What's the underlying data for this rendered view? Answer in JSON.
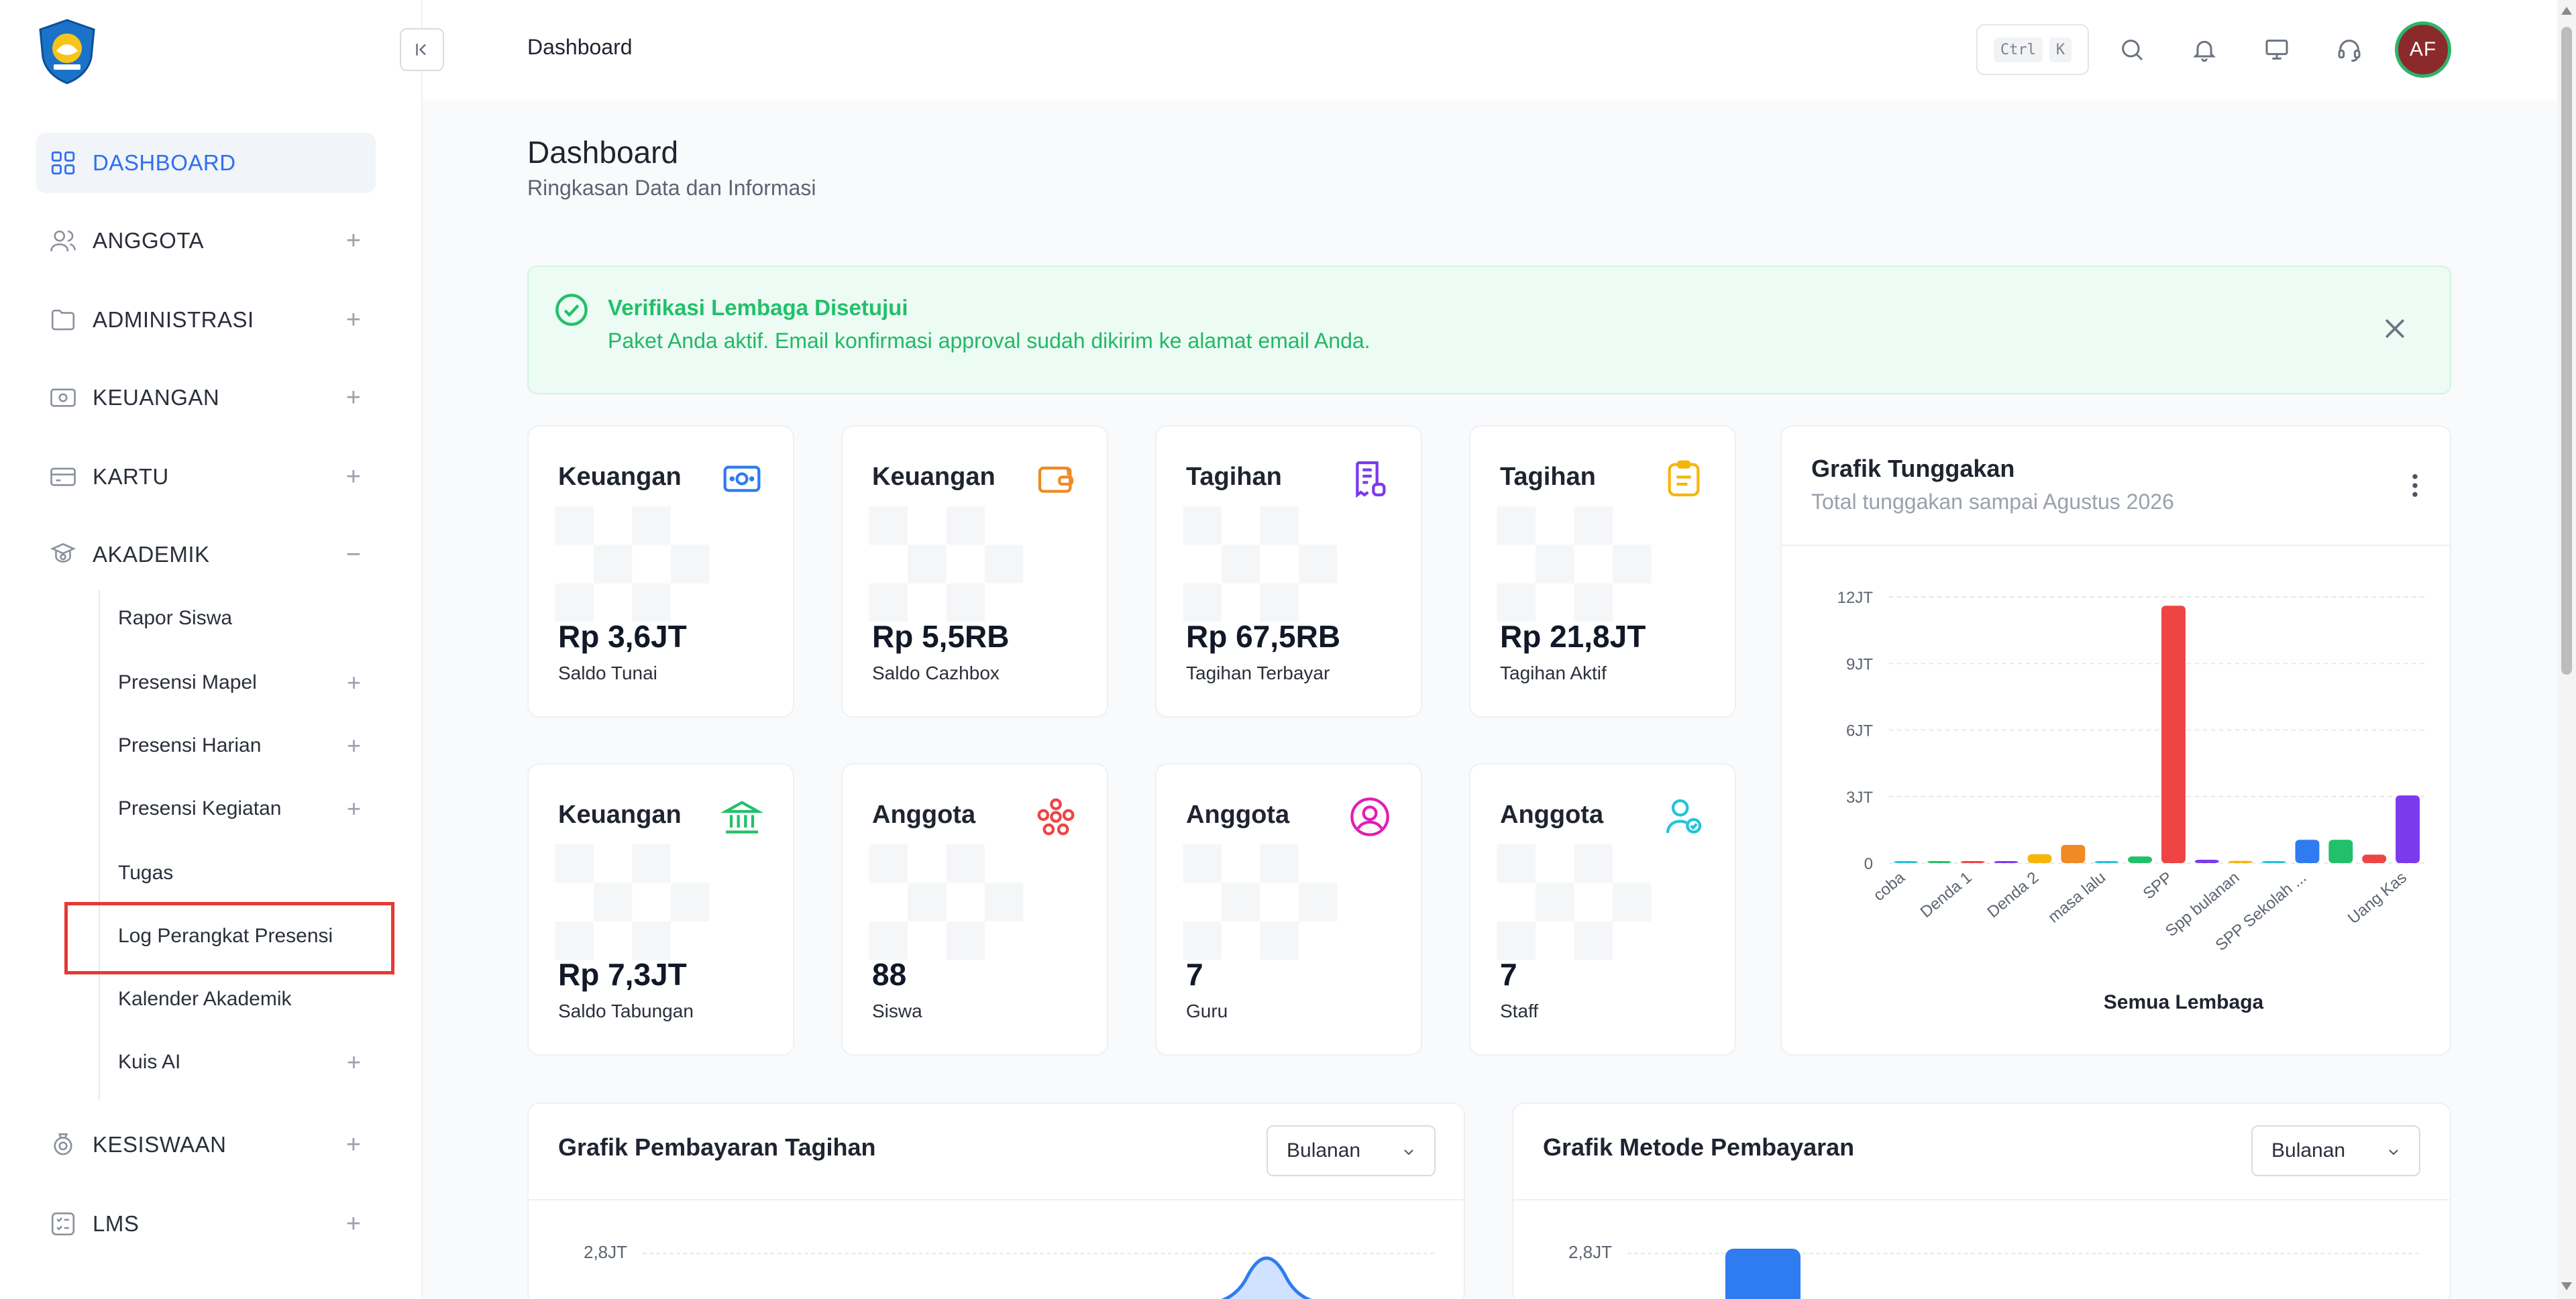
{
  "header": {
    "title": "Dashboard",
    "kbd_ctrl": "Ctrl",
    "kbd_k": "K",
    "avatar_initials": "AF"
  },
  "sidebar": {
    "items": [
      {
        "label": "DASHBOARD",
        "active": true,
        "icon": "grid-icon"
      },
      {
        "label": "ANGGOTA",
        "icon": "users-icon",
        "toggle": "+"
      },
      {
        "label": "ADMINISTRASI",
        "icon": "folder-icon",
        "toggle": "+"
      },
      {
        "label": "KEUANGAN",
        "icon": "banknote-icon",
        "toggle": "+"
      },
      {
        "label": "KARTU",
        "icon": "card-icon",
        "toggle": "+"
      },
      {
        "label": "AKADEMIK",
        "icon": "academic-icon",
        "toggle": "−"
      },
      {
        "label": "KESISWAAN",
        "icon": "student-icon",
        "toggle": "+"
      },
      {
        "label": "LMS",
        "icon": "list-icon",
        "toggle": "+"
      }
    ],
    "akademik_sub": [
      {
        "label": "Rapor Siswa"
      },
      {
        "label": "Presensi Mapel",
        "toggle": "+"
      },
      {
        "label": "Presensi Harian",
        "toggle": "+"
      },
      {
        "label": "Presensi Kegiatan",
        "toggle": "+"
      },
      {
        "label": "Tugas"
      },
      {
        "label": "Log Perangkat Presensi"
      },
      {
        "label": "Kalender Akademik"
      },
      {
        "label": "Kuis AI",
        "toggle": "+"
      }
    ]
  },
  "page": {
    "title": "Dashboard",
    "subtitle": "Ringkasan Data dan Informasi"
  },
  "alert": {
    "title": "Verifikasi Lembaga Disetujui",
    "message": "Paket Anda aktif. Email konfirmasi approval sudah dikirim ke alamat email Anda."
  },
  "cards": [
    {
      "title": "Keuangan",
      "value": "Rp 3,6JT",
      "label": "Saldo Tunai",
      "icon": "cash-icon",
      "color": "#2f7bf0"
    },
    {
      "title": "Keuangan",
      "value": "Rp 5,5RB",
      "label": "Saldo Cazhbox",
      "icon": "wallet-icon",
      "color": "#f08a24"
    },
    {
      "title": "Tagihan",
      "value": "Rp 67,5RB",
      "label": "Tagihan Terbayar",
      "icon": "receipt-icon",
      "color": "#7c3aed"
    },
    {
      "title": "Tagihan",
      "value": "Rp 21,8JT",
      "label": "Tagihan Aktif",
      "icon": "clipboard-icon",
      "color": "#f5b50a"
    },
    {
      "title": "Keuangan",
      "value": "Rp 7,3JT",
      "label": "Saldo Tabungan",
      "icon": "bank-icon",
      "color": "#22c06a"
    },
    {
      "title": "Anggota",
      "value": "88",
      "label": "Siswa",
      "icon": "group-icon",
      "color": "#ef4444"
    },
    {
      "title": "Anggota",
      "value": "7",
      "label": "Guru",
      "icon": "user-circle-icon",
      "color": "#e11db6"
    },
    {
      "title": "Anggota",
      "value": "7",
      "label": "Staff",
      "icon": "user-check-icon",
      "color": "#22c3d8"
    }
  ],
  "grafik_tunggakan": {
    "title": "Grafik Tunggakan",
    "subtitle": "Total tunggakan sampai Agustus 2026",
    "footer": "Semua Lembaga"
  },
  "chart_data": {
    "type": "bar",
    "title": "Grafik Tunggakan",
    "xlabel": "Semua Lembaga",
    "ylabel": "",
    "ylim": [
      0,
      12000000
    ],
    "yticks": [
      0,
      3000000,
      6000000,
      9000000,
      12000000
    ],
    "ytick_labels": [
      "0",
      "3JT",
      "6JT",
      "9JT",
      "12JT"
    ],
    "categories": [
      "coba",
      "",
      "Denda 1",
      "",
      "Denda 2",
      "",
      "masa lalu",
      "",
      "SPP",
      "",
      "Spp bulanan",
      "",
      "SPP Sekolah ...",
      "",
      "",
      "Uang Kas"
    ],
    "values": [
      15000,
      40000,
      60000,
      60000,
      400000,
      820000,
      30000,
      300000,
      11600000,
      150000,
      100000,
      30000,
      1050000,
      1050000,
      380000,
      3050000
    ],
    "colors": [
      "#22c3d8",
      "#22c06a",
      "#ef4444",
      "#7c3aed",
      "#f5b50a",
      "#f08a24",
      "#22c3d8",
      "#22c06a",
      "#ef4444",
      "#7c3aed",
      "#f5b50a",
      "#22c3d8",
      "#2f7bf0",
      "#22c06a",
      "#ef4444",
      "#7c3aed"
    ]
  },
  "bottom_charts": [
    {
      "title": "Grafik Pembayaran Tagihan",
      "select": "Bulanan",
      "ytick": "2,8JT"
    },
    {
      "title": "Grafik Metode Pembayaran",
      "select": "Bulanan",
      "ytick": "2,8JT"
    }
  ]
}
